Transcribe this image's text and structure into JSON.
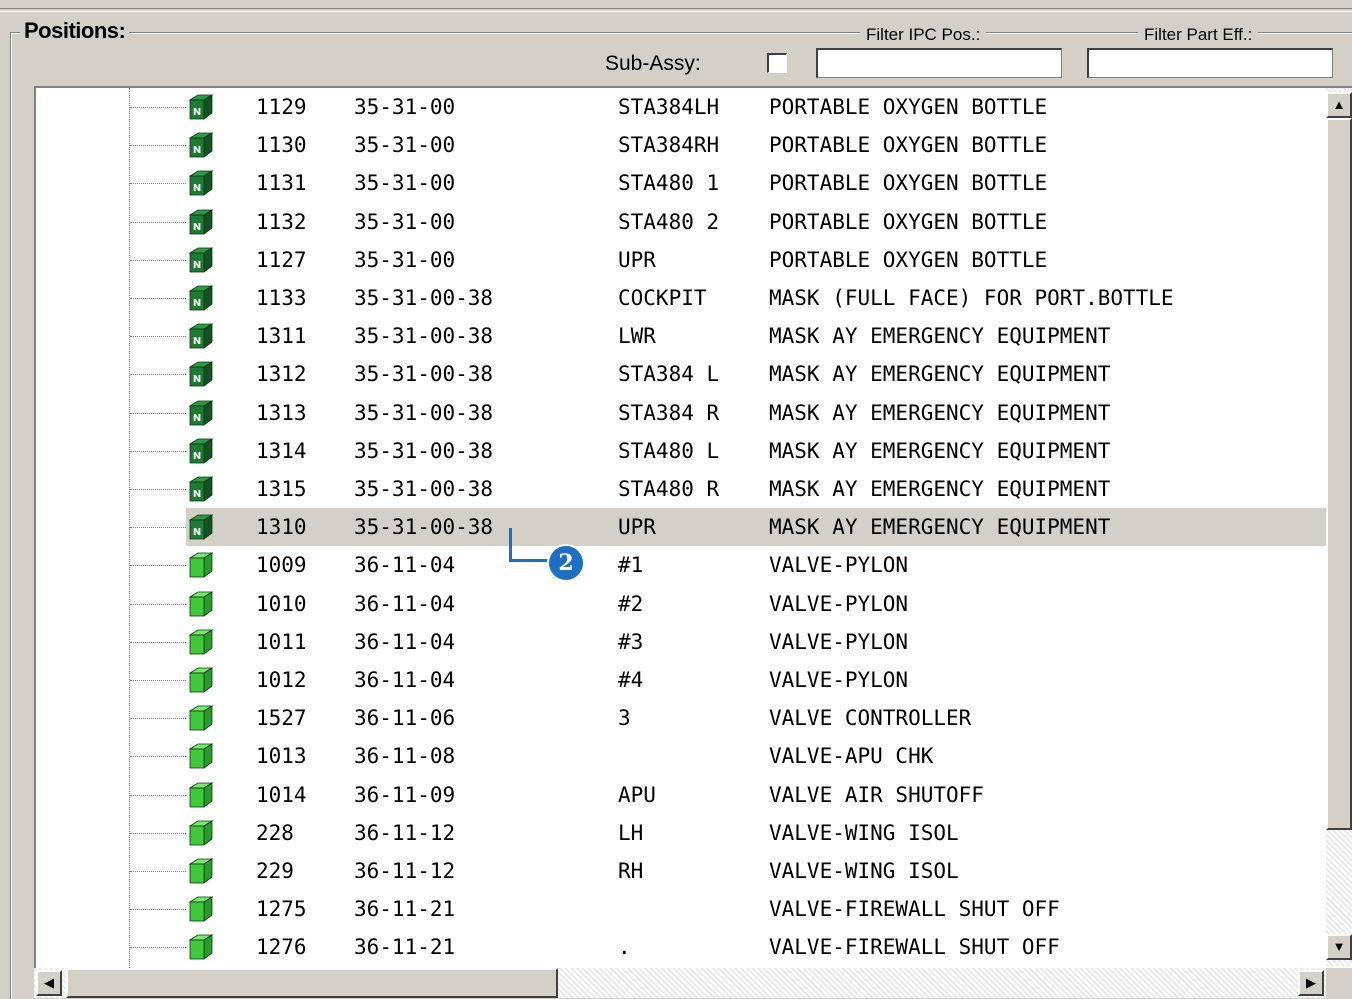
{
  "group_title": "Positions:",
  "filters": {
    "subassy_label": "Sub-Assy:",
    "subassy_checked": false,
    "ipc_label": "Filter IPC Pos.:",
    "ipc_value": "",
    "parteff_label": "Filter Part Eff.:",
    "parteff_value": ""
  },
  "rows": [
    {
      "pos": "1129",
      "ata": "35-31-00",
      "eff": "STA384LH",
      "desc": "PORTABLE OXYGEN BOTTLE",
      "icon": "dark-green-cube-icon"
    },
    {
      "pos": "1130",
      "ata": "35-31-00",
      "eff": "STA384RH",
      "desc": "PORTABLE OXYGEN BOTTLE",
      "icon": "dark-green-cube-icon"
    },
    {
      "pos": "1131",
      "ata": "35-31-00",
      "eff": "STA480 1",
      "desc": "PORTABLE OXYGEN BOTTLE",
      "icon": "dark-green-cube-icon"
    },
    {
      "pos": "1132",
      "ata": "35-31-00",
      "eff": "STA480 2",
      "desc": "PORTABLE OXYGEN BOTTLE",
      "icon": "dark-green-cube-icon"
    },
    {
      "pos": "1127",
      "ata": "35-31-00",
      "eff": "UPR",
      "desc": "PORTABLE OXYGEN BOTTLE",
      "icon": "dark-green-cube-icon"
    },
    {
      "pos": "1133",
      "ata": "35-31-00-38",
      "eff": "COCKPIT",
      "desc": "MASK (FULL FACE) FOR PORT.BOTTLE",
      "icon": "dark-green-cube-icon"
    },
    {
      "pos": "1311",
      "ata": "35-31-00-38",
      "eff": "LWR",
      "desc": "MASK AY EMERGENCY EQUIPMENT",
      "icon": "dark-green-cube-icon"
    },
    {
      "pos": "1312",
      "ata": "35-31-00-38",
      "eff": "STA384 L",
      "desc": "MASK AY EMERGENCY EQUIPMENT",
      "icon": "dark-green-cube-icon"
    },
    {
      "pos": "1313",
      "ata": "35-31-00-38",
      "eff": "STA384 R",
      "desc": "MASK AY EMERGENCY EQUIPMENT",
      "icon": "dark-green-cube-icon"
    },
    {
      "pos": "1314",
      "ata": "35-31-00-38",
      "eff": "STA480 L",
      "desc": "MASK AY EMERGENCY EQUIPMENT",
      "icon": "dark-green-cube-icon"
    },
    {
      "pos": "1315",
      "ata": "35-31-00-38",
      "eff": "STA480 R",
      "desc": "MASK AY EMERGENCY EQUIPMENT",
      "icon": "dark-green-cube-icon"
    },
    {
      "pos": "1310",
      "ata": "35-31-00-38",
      "eff": "UPR",
      "desc": "MASK AY EMERGENCY EQUIPMENT",
      "icon": "dark-green-cube-icon",
      "selected": true
    },
    {
      "pos": "1009",
      "ata": "36-11-04",
      "eff": "#1",
      "desc": "VALVE-PYLON",
      "icon": "light-green-cube-icon"
    },
    {
      "pos": "1010",
      "ata": "36-11-04",
      "eff": "#2",
      "desc": "VALVE-PYLON",
      "icon": "light-green-cube-icon"
    },
    {
      "pos": "1011",
      "ata": "36-11-04",
      "eff": "#3",
      "desc": "VALVE-PYLON",
      "icon": "light-green-cube-icon"
    },
    {
      "pos": "1012",
      "ata": "36-11-04",
      "eff": "#4",
      "desc": "VALVE-PYLON",
      "icon": "light-green-cube-icon"
    },
    {
      "pos": "1527",
      "ata": "36-11-06",
      "eff": "3",
      "desc": "VALVE CONTROLLER",
      "icon": "light-green-cube-icon"
    },
    {
      "pos": "1013",
      "ata": "36-11-08",
      "eff": "",
      "desc": "VALVE-APU CHK",
      "icon": "light-green-cube-icon"
    },
    {
      "pos": "1014",
      "ata": "36-11-09",
      "eff": "APU",
      "desc": "VALVE AIR SHUTOFF",
      "icon": "light-green-cube-icon"
    },
    {
      "pos": "228",
      "ata": "36-11-12",
      "eff": "LH",
      "desc": "VALVE-WING ISOL",
      "icon": "light-green-cube-icon"
    },
    {
      "pos": "229",
      "ata": "36-11-12",
      "eff": "RH",
      "desc": "VALVE-WING ISOL",
      "icon": "light-green-cube-icon"
    },
    {
      "pos": "1275",
      "ata": "36-11-21",
      "eff": "",
      "desc": "VALVE-FIREWALL SHUT OFF",
      "icon": "light-green-cube-icon"
    },
    {
      "pos": "1276",
      "ata": "36-11-21",
      "eff": ".",
      "desc": "VALVE-FIREWALL SHUT OFF",
      "icon": "light-green-cube-icon"
    }
  ],
  "callout": {
    "number": "2",
    "color": "#1e6fc4"
  },
  "colors": {
    "dark_cube": "#1f7a33",
    "light_cube": "#3fc83a",
    "selection": "#d4d0c8"
  }
}
